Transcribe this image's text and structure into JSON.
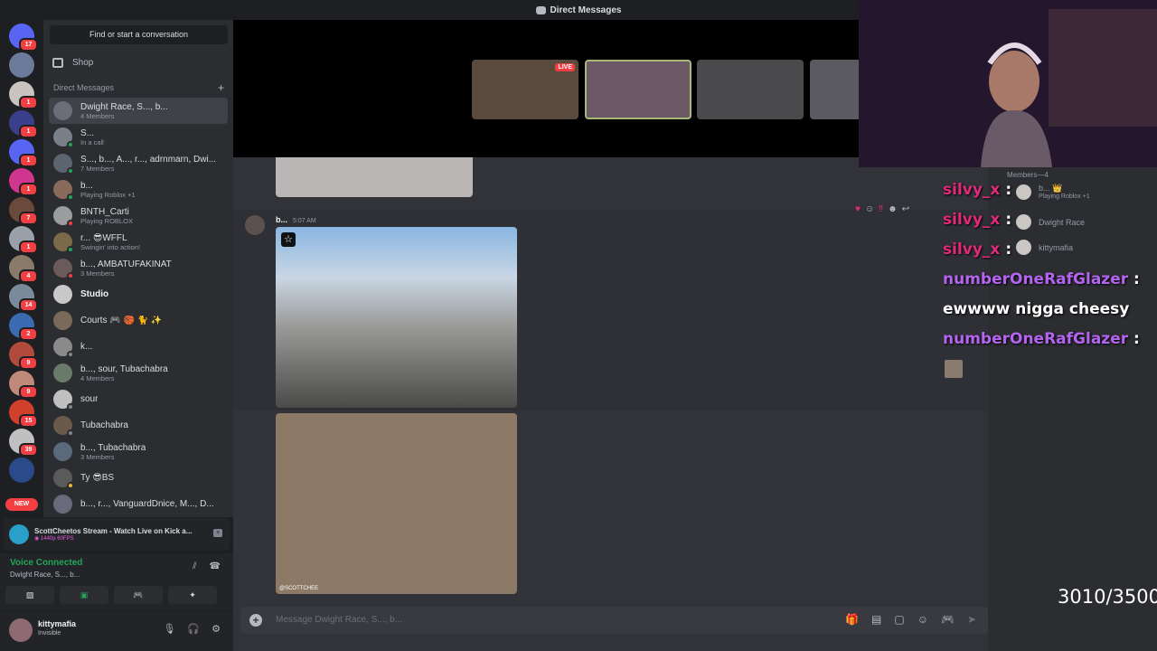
{
  "window": {
    "title": "Direct Messages"
  },
  "sidebar": {
    "search_label": "Find or start a conversation",
    "shop_label": "Shop",
    "dm_section_label": "Direct Messages",
    "dms": [
      {
        "name": "Dwight Race, S..., b...",
        "sub": "4 Members"
      },
      {
        "name": "S...",
        "sub": "In a call"
      },
      {
        "name": "S..., b..., A..., r..., adrnmarn, Dwi...",
        "sub": "7 Members"
      },
      {
        "name": "b...",
        "sub": "Playing Roblox +1"
      },
      {
        "name": "BNTH_Carti",
        "sub": "Playing ROBLOX"
      },
      {
        "name": "r... 😎WFFL",
        "sub": "Swingin' into action!"
      },
      {
        "name": "b..., AMBATUFAKINAT",
        "sub": "3 Members"
      },
      {
        "name": "Studio",
        "sub": ""
      },
      {
        "name": "Courts 🎮 🏀 🐈 ✨",
        "sub": ""
      },
      {
        "name": "k...",
        "sub": ""
      },
      {
        "name": "b..., sour, Tubachabra",
        "sub": "4 Members"
      },
      {
        "name": "sour",
        "sub": ""
      },
      {
        "name": "Tubachabra",
        "sub": ""
      },
      {
        "name": "b..., Tubachabra",
        "sub": "3 Members"
      },
      {
        "name": "Ty 😎BS",
        "sub": ""
      },
      {
        "name": "b..., r..., VanguardDnice, M..., D...",
        "sub": ""
      }
    ]
  },
  "servers": [
    {
      "badge": "17",
      "color": "#5865f2"
    },
    {
      "badge": "",
      "color": "#6b7b9c"
    },
    {
      "badge": "1",
      "color": "#c9c4c0"
    },
    {
      "badge": "1",
      "color": "#3a3f8c"
    },
    {
      "badge": "1",
      "color": "#5865f2"
    },
    {
      "badge": "1",
      "color": "#d0358f"
    },
    {
      "badge": "7",
      "color": "#6a4a3a"
    },
    {
      "badge": "1",
      "color": "#9aa0a8"
    },
    {
      "badge": "4",
      "color": "#8a7a6a"
    },
    {
      "badge": "14",
      "color": "#7a8a9a"
    },
    {
      "badge": "2",
      "color": "#3a6ab0"
    },
    {
      "badge": "9",
      "color": "#b04a3a"
    },
    {
      "badge": "9",
      "color": "#c08a7a"
    },
    {
      "badge": "15",
      "color": "#d0402a"
    },
    {
      "badge": "39",
      "color": "#c0c0c0"
    },
    {
      "badge": "",
      "color": "#2a4a8a"
    }
  ],
  "new_pill": "NEW",
  "stream_card": {
    "title": "ScottCheetos Stream - Watch Live on Kick a...",
    "sub": "◉ 1440p 60FPS"
  },
  "voice": {
    "title": "Voice Connected",
    "channel": "Dwight Race, S..., b..."
  },
  "user": {
    "name": "kittymafia",
    "status": "Invisible"
  },
  "chat": {
    "live_label": "LIVE",
    "message": {
      "author": "b...",
      "time": "5:07 AM"
    },
    "image2_caption": "@SCOTTCHEE",
    "composer_placeholder": "Message Dwight Race, S..., b..."
  },
  "members": {
    "header": "Members—4",
    "list": [
      {
        "name": "b... 👑",
        "sub": "Playing Roblox +1"
      },
      {
        "name": "Dwight Race",
        "sub": ""
      },
      {
        "name": "kittymafia",
        "sub": ""
      }
    ]
  },
  "overlay_chat": [
    {
      "user": "silvy_x",
      "colon": ":",
      "msg": ""
    },
    {
      "user": "silvy_x",
      "colon": ":",
      "msg": ""
    },
    {
      "user": "silvy_x",
      "colon": ":",
      "msg": ""
    },
    {
      "user": "numberOneRafGlazer",
      "colon": ":",
      "msg": "ewwww nigga cheesy"
    },
    {
      "user": "numberOneRafGlazer",
      "colon": ":",
      "msg": ""
    }
  ],
  "counter": "3010/3500"
}
